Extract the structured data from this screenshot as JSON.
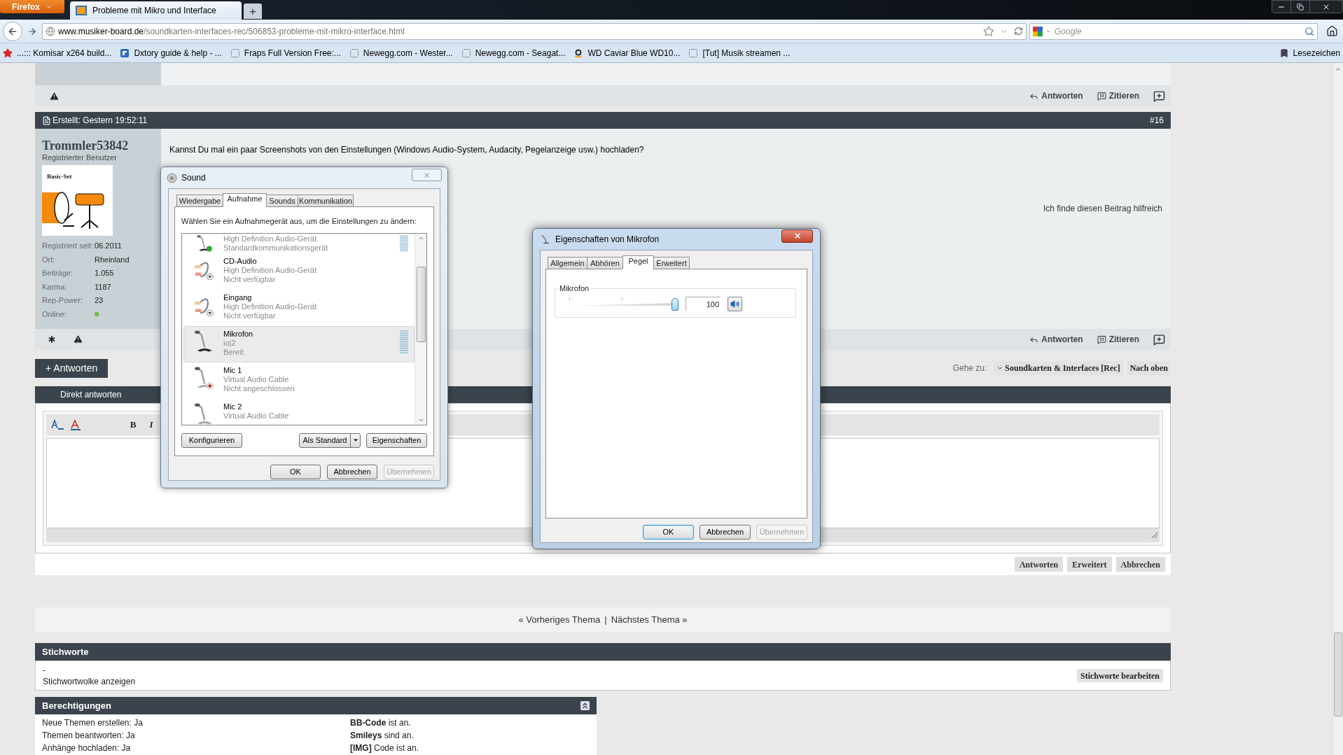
{
  "browser": {
    "menu_button": "Firefox",
    "tabs": [
      {
        "title": "Probleme mit Mikro und Interface",
        "selected": true
      }
    ],
    "new_tab": "+",
    "url_host": "www.musiker-board.de",
    "url_path": "/soundkarten-interfaces-rec/506853-probleme-mit-mikro-interface.html",
    "search": {
      "placeholder": "Google"
    },
    "bookmarks": [
      {
        "label": "...::: Komisar x264 build...",
        "kind": "star"
      },
      {
        "label": "Dxtory guide & help - ...",
        "kind": "g"
      },
      {
        "label": "Fraps Full Version Free:...",
        "kind": "blank"
      },
      {
        "label": "Newegg.com - Wester...",
        "kind": "blank"
      },
      {
        "label": "Newegg.com - Seagat...",
        "kind": "blank"
      },
      {
        "label": "WD Caviar Blue WD10...",
        "kind": "amazon"
      },
      {
        "label": "[Tut] Musik streamen ...",
        "kind": "blank"
      }
    ],
    "bookmarks_menu": "Lesezeichen"
  },
  "post": {
    "actions_top": [
      "Antworten",
      "Zitieren"
    ],
    "created": "Erstellt: Gestern 19:52:11",
    "number": "#16",
    "author": "Trommler53842",
    "role": "Registrierter Benutzer",
    "avatar_label": "Basic-Set",
    "stats": [
      {
        "label": "Registriert seit:",
        "value": "06.2011"
      },
      {
        "label": "Ort:",
        "value": "Rheinland"
      },
      {
        "label": "Beiträge:",
        "value": "1.055"
      },
      {
        "label": "Karma:",
        "value": "1187"
      },
      {
        "label": "Rep-Power:",
        "value": "23"
      }
    ],
    "online_label": "Online:",
    "online": true,
    "message": "Kannst Du mal ein paar Screenshots von den Einstellungen (Windows Audio-System, Audacity, Pegelanzeige usw.) hochladen?",
    "helpful": "Ich finde diesen Beitrag hilfreich",
    "actions_bottom": [
      "Antworten",
      "Zitieren"
    ]
  },
  "reply_button": "+ Antworten",
  "goto": {
    "label": "Gehe zu:",
    "forum": "Soundkarten & Interfaces [Rec]",
    "top": "Nach oben"
  },
  "quick_reply": {
    "title": "Direkt antworten",
    "format_buttons": [
      "B",
      "I"
    ],
    "buttons": [
      "Antworten",
      "Erweitert",
      "Abbrechen"
    ]
  },
  "thread_nav": {
    "previous": "« Vorheriges Thema",
    "separator": "|",
    "next": "Nächstes Thema »"
  },
  "tags": {
    "title": "Stichworte",
    "value": "-",
    "cloud_link": "Stichwortwolke anzeigen",
    "edit_button": "Stichworte bearbeiten"
  },
  "permissions": {
    "title": "Berechtigungen",
    "left": [
      "Neue Themen erstellen: Ja",
      "Themen beantworten: Ja",
      "Anhänge hochladen: Ja"
    ],
    "right": [
      "**BB-Code** ist an.",
      "**Smileys** sind an.",
      "**[IMG]** Code ist an."
    ]
  },
  "sound": {
    "title": "Sound",
    "tabs": [
      {
        "label": "Wiedergabe",
        "selected": false
      },
      {
        "label": "Aufnahme",
        "selected": true
      },
      {
        "label": "Sounds",
        "selected": false
      },
      {
        "label": "Kommunikation",
        "selected": false
      }
    ],
    "instruction": "Wählen Sie ein Aufnahmegerät aus, um die Einstellungen zu ändern:",
    "devices": [
      {
        "driver": "High Definition Audio-Gerät",
        "status": "Standardkommunikationsgerät",
        "kind": "mic",
        "default_device": true,
        "unavailable": false,
        "disconnected": false,
        "meter": true,
        "selected": false
      },
      {
        "name": "CD-Audio",
        "driver": "High Definition Audio-Gerät",
        "status": "Nicht verfügbar",
        "kind": "cable",
        "default_device": false,
        "unavailable": true,
        "disconnected": false,
        "meter": false,
        "selected": false
      },
      {
        "name": "Eingang",
        "driver": "High Definition Audio-Gerät",
        "status": "Nicht verfügbar",
        "kind": "cable",
        "default_device": false,
        "unavailable": true,
        "disconnected": false,
        "meter": false,
        "selected": false
      },
      {
        "name": "Mikrofon",
        "driver": "io|2",
        "status": "Bereit",
        "kind": "mic",
        "default_device": false,
        "unavailable": false,
        "disconnected": false,
        "meter": true,
        "selected": true
      },
      {
        "name": "Mic 1",
        "driver": "Virtual Audio Cable",
        "status": "Nicht angeschlossen",
        "kind": "mic",
        "default_device": false,
        "unavailable": false,
        "disconnected": true,
        "meter": false,
        "selected": false
      },
      {
        "name": "Mic 2",
        "driver": "Virtual Audio Cable",
        "kind": "mic",
        "meter": false,
        "selected": false
      }
    ],
    "buttons": [
      {
        "label": "Konfigurieren",
        "disabled": false
      },
      {
        "label": "Als Standard",
        "disabled": false
      },
      {
        "label": "Eigenschaften",
        "disabled": false
      }
    ],
    "dialog_buttons": [
      {
        "label": "OK",
        "disabled": false
      },
      {
        "label": "Abbrechen",
        "disabled": false
      },
      {
        "label": "Übernehmen",
        "disabled": true
      }
    ]
  },
  "properties": {
    "title": "Eigenschaften von Mikrofon",
    "tabs": [
      {
        "label": "Allgemein",
        "selected": false
      },
      {
        "label": "Abhören",
        "selected": false
      },
      {
        "label": "Pegel",
        "selected": true
      },
      {
        "label": "Erweitert",
        "selected": false
      }
    ],
    "group": "Mikrofon",
    "level": 1,
    "value": "100",
    "muted": false,
    "dialog_buttons": [
      {
        "label": "OK",
        "disabled": false,
        "default": true
      },
      {
        "label": "Abbrechen",
        "disabled": false,
        "default": false
      },
      {
        "label": "Übernehmen",
        "disabled": true,
        "default": false
      }
    ]
  }
}
